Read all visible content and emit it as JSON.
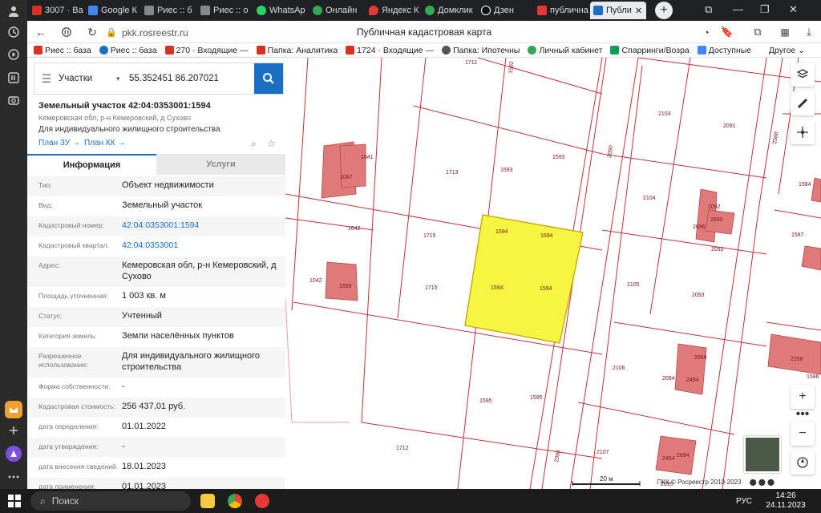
{
  "browser": {
    "tabs": [
      {
        "label": "3007 · Ва",
        "color": "#d93025"
      },
      {
        "label": "Google К",
        "color": "#4285f4"
      },
      {
        "label": "Риес :: б",
        "color": "#888888"
      },
      {
        "label": "Риес :: о",
        "color": "#888888"
      },
      {
        "label": "WhatsAp",
        "color": "#25d366"
      },
      {
        "label": "Онлайн",
        "color": "#34a853"
      },
      {
        "label": "Яндекс К",
        "color": "#e53935"
      },
      {
        "label": "Домклик",
        "color": "#34a853"
      },
      {
        "label": "Дзен",
        "color": "#111111"
      },
      {
        "label": "публична",
        "color": "#e53935"
      },
      {
        "label": "Публи",
        "color": "#1a6ec4",
        "active": true
      }
    ],
    "url": "pkk.rosreestr.ru",
    "page_title": "Публичная кадастровая карта",
    "bookmarks": [
      {
        "label": "Риес :: база",
        "color": "#1a6ec4"
      },
      {
        "label": "Риес :: база",
        "color": "#1a6ec4"
      },
      {
        "label": "270 · Входящие —",
        "color": "#d93025"
      },
      {
        "label": "Папка: Аналитика",
        "color": "#d93025"
      },
      {
        "label": "1724 · Входящие —",
        "color": "#d93025"
      },
      {
        "label": "Папка: Ипотечны",
        "color": "#555555"
      },
      {
        "label": "Личный кабинет",
        "color": "#34a853"
      },
      {
        "label": "Спарринги/Возра",
        "color": "#0f9d58"
      },
      {
        "label": "Доступные",
        "color": "#4285f4"
      }
    ],
    "bookmarks_other": "Другое"
  },
  "search": {
    "layer": "Участки",
    "coordinates": "55.352451 86.207021"
  },
  "object": {
    "title": "Земельный участок 42:04:0353001:1594",
    "address_short": "Кемеровская обл, р-н Кемеровский, д Сухово",
    "usage": "Для индивидуального жилищного строительства",
    "plan_zu": "План ЗУ →",
    "plan_kk": "План КК →"
  },
  "panel_tabs": {
    "info": "Информация",
    "services": "Услуги"
  },
  "info_rows": [
    {
      "k": "Тип:",
      "v": "Объект недвижимости"
    },
    {
      "k": "Вид:",
      "v": "Земельный участок"
    },
    {
      "k": "Кадастровый номер:",
      "v": "42:04:0353001:1594",
      "link": true
    },
    {
      "k": "Кадастровый квартал:",
      "v": "42:04:0353001",
      "link": true
    },
    {
      "k": "Адрес:",
      "v": "Кемеровская обл, р-н Кемеровский, д Сухово"
    },
    {
      "k": "Площадь уточненная:",
      "v": "1 003 кв. м"
    },
    {
      "k": "Статус:",
      "v": "Учтенный"
    },
    {
      "k": "Категория земель:",
      "v": "Земли населённых пунктов"
    },
    {
      "k": "Разрешенное использование:",
      "v": "Для индивидуального жилищного строительства"
    },
    {
      "k": "Форма собственности:",
      "v": "-"
    },
    {
      "k": "Кадастровая стоимость:",
      "v": "256 437,01 руб."
    },
    {
      "k": "дата определения:",
      "v": "01.01.2022"
    },
    {
      "k": "дата утверждения:",
      "v": "-"
    },
    {
      "k": "дата внесения сведений:",
      "v": "18.01.2023"
    },
    {
      "k": "дата применения:",
      "v": "01.01.2023"
    }
  ],
  "map": {
    "parcel_labels": [
      "1711",
      "1592",
      "1713",
      "1593",
      "1593",
      "2103",
      "2091",
      "2088",
      "1584",
      "2104",
      "2092",
      "2690",
      "2696",
      "1041",
      "1087",
      "1042",
      "1715",
      "1594",
      "1594",
      "2090",
      "1587",
      "2092",
      "1042",
      "1699",
      "1715",
      "1594",
      "1594",
      "2105",
      "2093",
      "2106",
      "2094",
      "2494",
      "2689",
      "2266",
      "1586",
      "1595",
      "1595",
      "1712",
      "2090",
      "2107",
      "2095",
      "2494",
      "2694"
    ],
    "scale_label": "20 м",
    "copyright": "ПКК © Росреестр 2010-2023",
    "highlight_color": "#f5f542",
    "building_color": "#e07a7a"
  },
  "taskbar": {
    "search": "Поиск",
    "lang": "РУС",
    "time": "14:26",
    "date": "24.11.2023"
  }
}
